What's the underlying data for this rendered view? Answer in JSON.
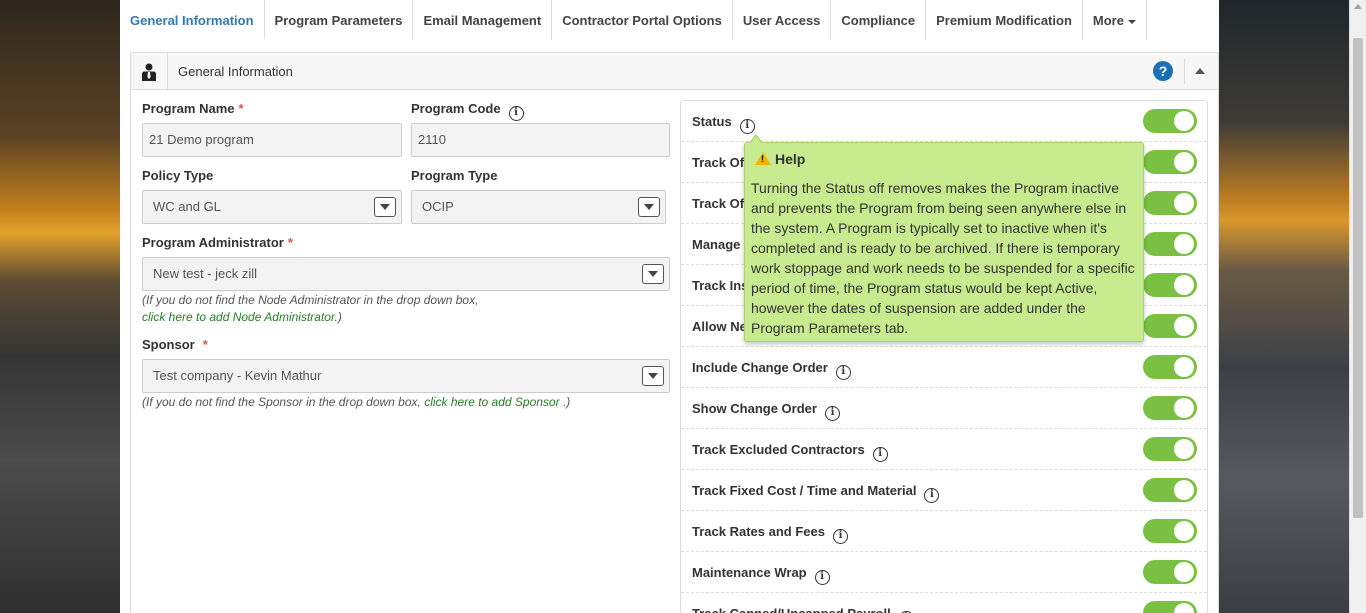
{
  "tabs": [
    {
      "label": "General Information",
      "active": true
    },
    {
      "label": "Program Parameters"
    },
    {
      "label": "Email Management"
    },
    {
      "label": "Contractor Portal Options"
    },
    {
      "label": "User Access"
    },
    {
      "label": "Compliance"
    },
    {
      "label": "Premium Modification"
    },
    {
      "label": "More"
    }
  ],
  "panel": {
    "title": "General Information",
    "help_glyph": "?"
  },
  "form": {
    "program_name": {
      "label": "Program Name",
      "value": "21 Demo program"
    },
    "program_code": {
      "label": "Program Code",
      "value": "2110"
    },
    "policy_type": {
      "label": "Policy Type",
      "value": "WC and GL"
    },
    "program_type": {
      "label": "Program Type",
      "value": "OCIP"
    },
    "program_admin": {
      "label": "Program Administrator",
      "value": "New test - jeck zill",
      "note_line1": "(If you do not find the Node Administrator in the drop down box,",
      "note_link": "click here to add Node Administrator.",
      "note_end": ")"
    },
    "sponsor": {
      "label": "Sponsor",
      "value": "Test company - Kevin Mathur",
      "note_start": "(If you do not find the Sponsor in the drop down box, ",
      "note_link": "click here to add Sponsor",
      "note_end": " .)"
    },
    "required_mark": "*",
    "info_glyph": "i"
  },
  "settings": [
    {
      "label": "Status",
      "on": true
    },
    {
      "label": "Track Off",
      "on": true
    },
    {
      "label": "Track Off",
      "on": true
    },
    {
      "label": "Manage",
      "on": true
    },
    {
      "label": "Track Ins",
      "on": true
    },
    {
      "label": "Allow Ne",
      "on": true
    },
    {
      "label": "Include Change Order",
      "on": true
    },
    {
      "label": "Show Change Order",
      "on": true
    },
    {
      "label": "Track Excluded Contractors",
      "on": true
    },
    {
      "label": "Track Fixed Cost / Time and Material",
      "on": true
    },
    {
      "label": "Track Rates and Fees",
      "on": true
    },
    {
      "label": "Maintenance Wrap",
      "on": true
    },
    {
      "label": "Track Capped/Uncapped Payroll",
      "on": true
    }
  ],
  "tooltip": {
    "title": "Help",
    "body": "Turning the Status off removes makes the Program inactive and prevents the Program from being seen anywhere else in the system. A Program is typically set to inactive when it's completed and is ready to be archived. If there is temporary work stoppage and work needs to be suspended for a specific period of time, the Program status would be kept Active, however the dates of suspension are added under the Program Parameters tab."
  },
  "colors": {
    "accent": "#337ab7",
    "toggle_on": "#7ac143",
    "tooltip_bg": "#c7eb8e",
    "required": "#d9534f",
    "link": "#2a7a2a"
  }
}
